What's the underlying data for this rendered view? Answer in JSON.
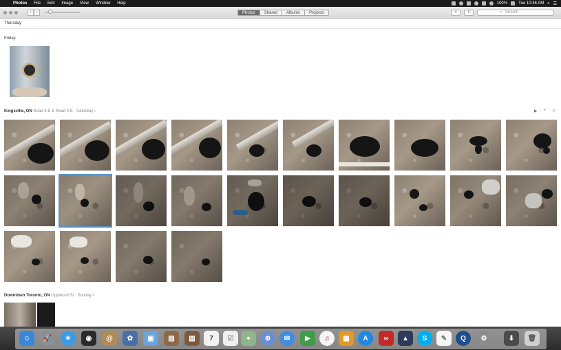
{
  "menubar": {
    "app_name": "Photos",
    "menus": [
      "File",
      "Edit",
      "Image",
      "View",
      "Window",
      "Help"
    ],
    "battery": "100%",
    "clock": "Tue 10:46 AM"
  },
  "toolbar": {
    "tabs": [
      "Photos",
      "Shared",
      "Albums",
      "Projects"
    ],
    "active_tab": "Photos",
    "search_placeholder": "Search"
  },
  "sections": {
    "thursday": {
      "title": "Thursday"
    },
    "friday": {
      "title": "Friday"
    },
    "kingsville": {
      "place": "Kingsville, ON",
      "meta": "Road 5 E & Road 4 E · Saturday ›"
    },
    "toronto": {
      "place": "Downtown Toronto, ON",
      "meta": "Lippincott St · Sunday ›"
    }
  },
  "icons": {
    "play": "play-icon",
    "add": "plus-icon",
    "share": "share-icon"
  },
  "colors": {
    "selection": "#5b9bd5",
    "active_tab": "#6d6d6d"
  },
  "dock": {
    "apps": [
      "Finder",
      "Launchpad",
      "Safari",
      "Photo Booth",
      "Contacts",
      "Photos",
      "Preview",
      "Notes",
      "Calendar",
      "Reminders",
      "Maps",
      "Messages",
      "FaceTime",
      "iTunes",
      "iBooks",
      "App Store",
      "Creative Cloud",
      "Terminal",
      "Skype",
      "TextEdit",
      "QuickTime",
      "System Preferences",
      "Downloads",
      "Trash"
    ]
  }
}
